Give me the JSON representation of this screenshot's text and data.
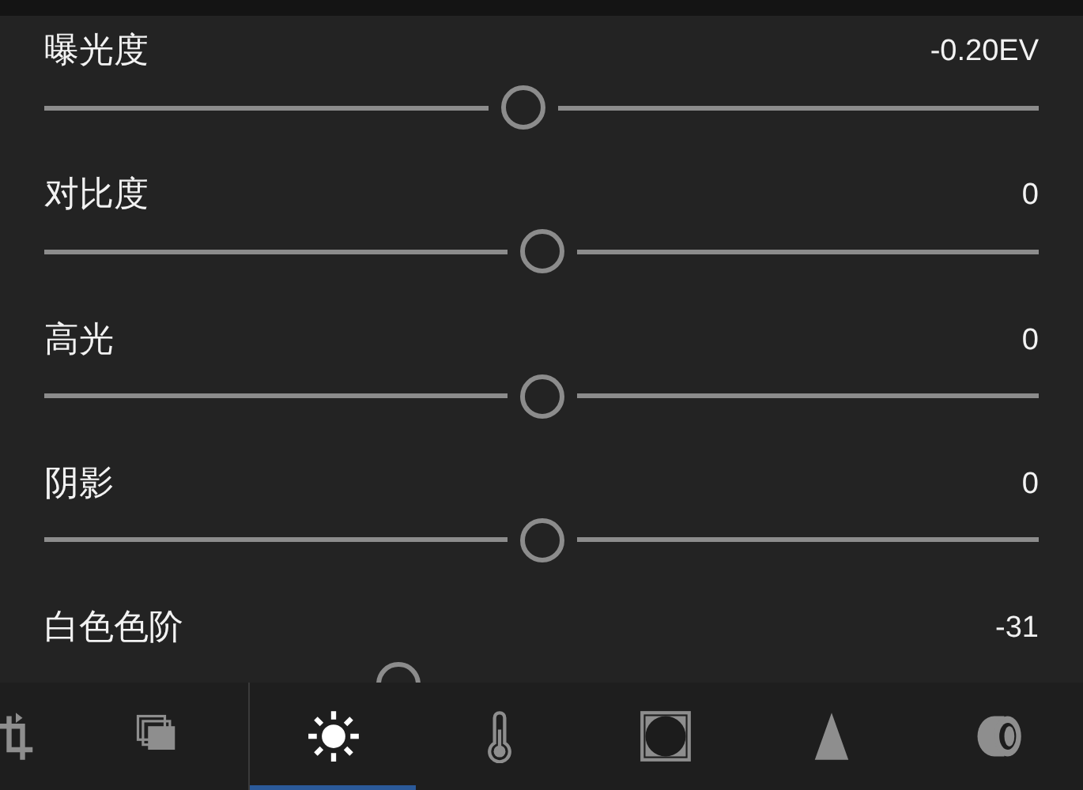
{
  "adjustments": [
    {
      "label": "曝光度",
      "value": "-0.20EV",
      "level": 0.48
    },
    {
      "label": "对比度",
      "value": "0",
      "level": 0.5
    },
    {
      "label": "高光",
      "value": "0",
      "level": 0.5
    },
    {
      "label": "阴影",
      "value": "0",
      "level": 0.5
    },
    {
      "label": "白色色阶",
      "value": "-31",
      "level": 0.345
    }
  ],
  "toolbar": {
    "tabs": [
      {
        "kind": "crop",
        "selected": false
      },
      {
        "kind": "presets",
        "selected": false
      },
      {
        "kind": "light",
        "selected": true
      },
      {
        "kind": "color",
        "selected": false
      },
      {
        "kind": "effects",
        "selected": false
      },
      {
        "kind": "detail",
        "selected": false
      },
      {
        "kind": "optics",
        "selected": false
      }
    ]
  }
}
